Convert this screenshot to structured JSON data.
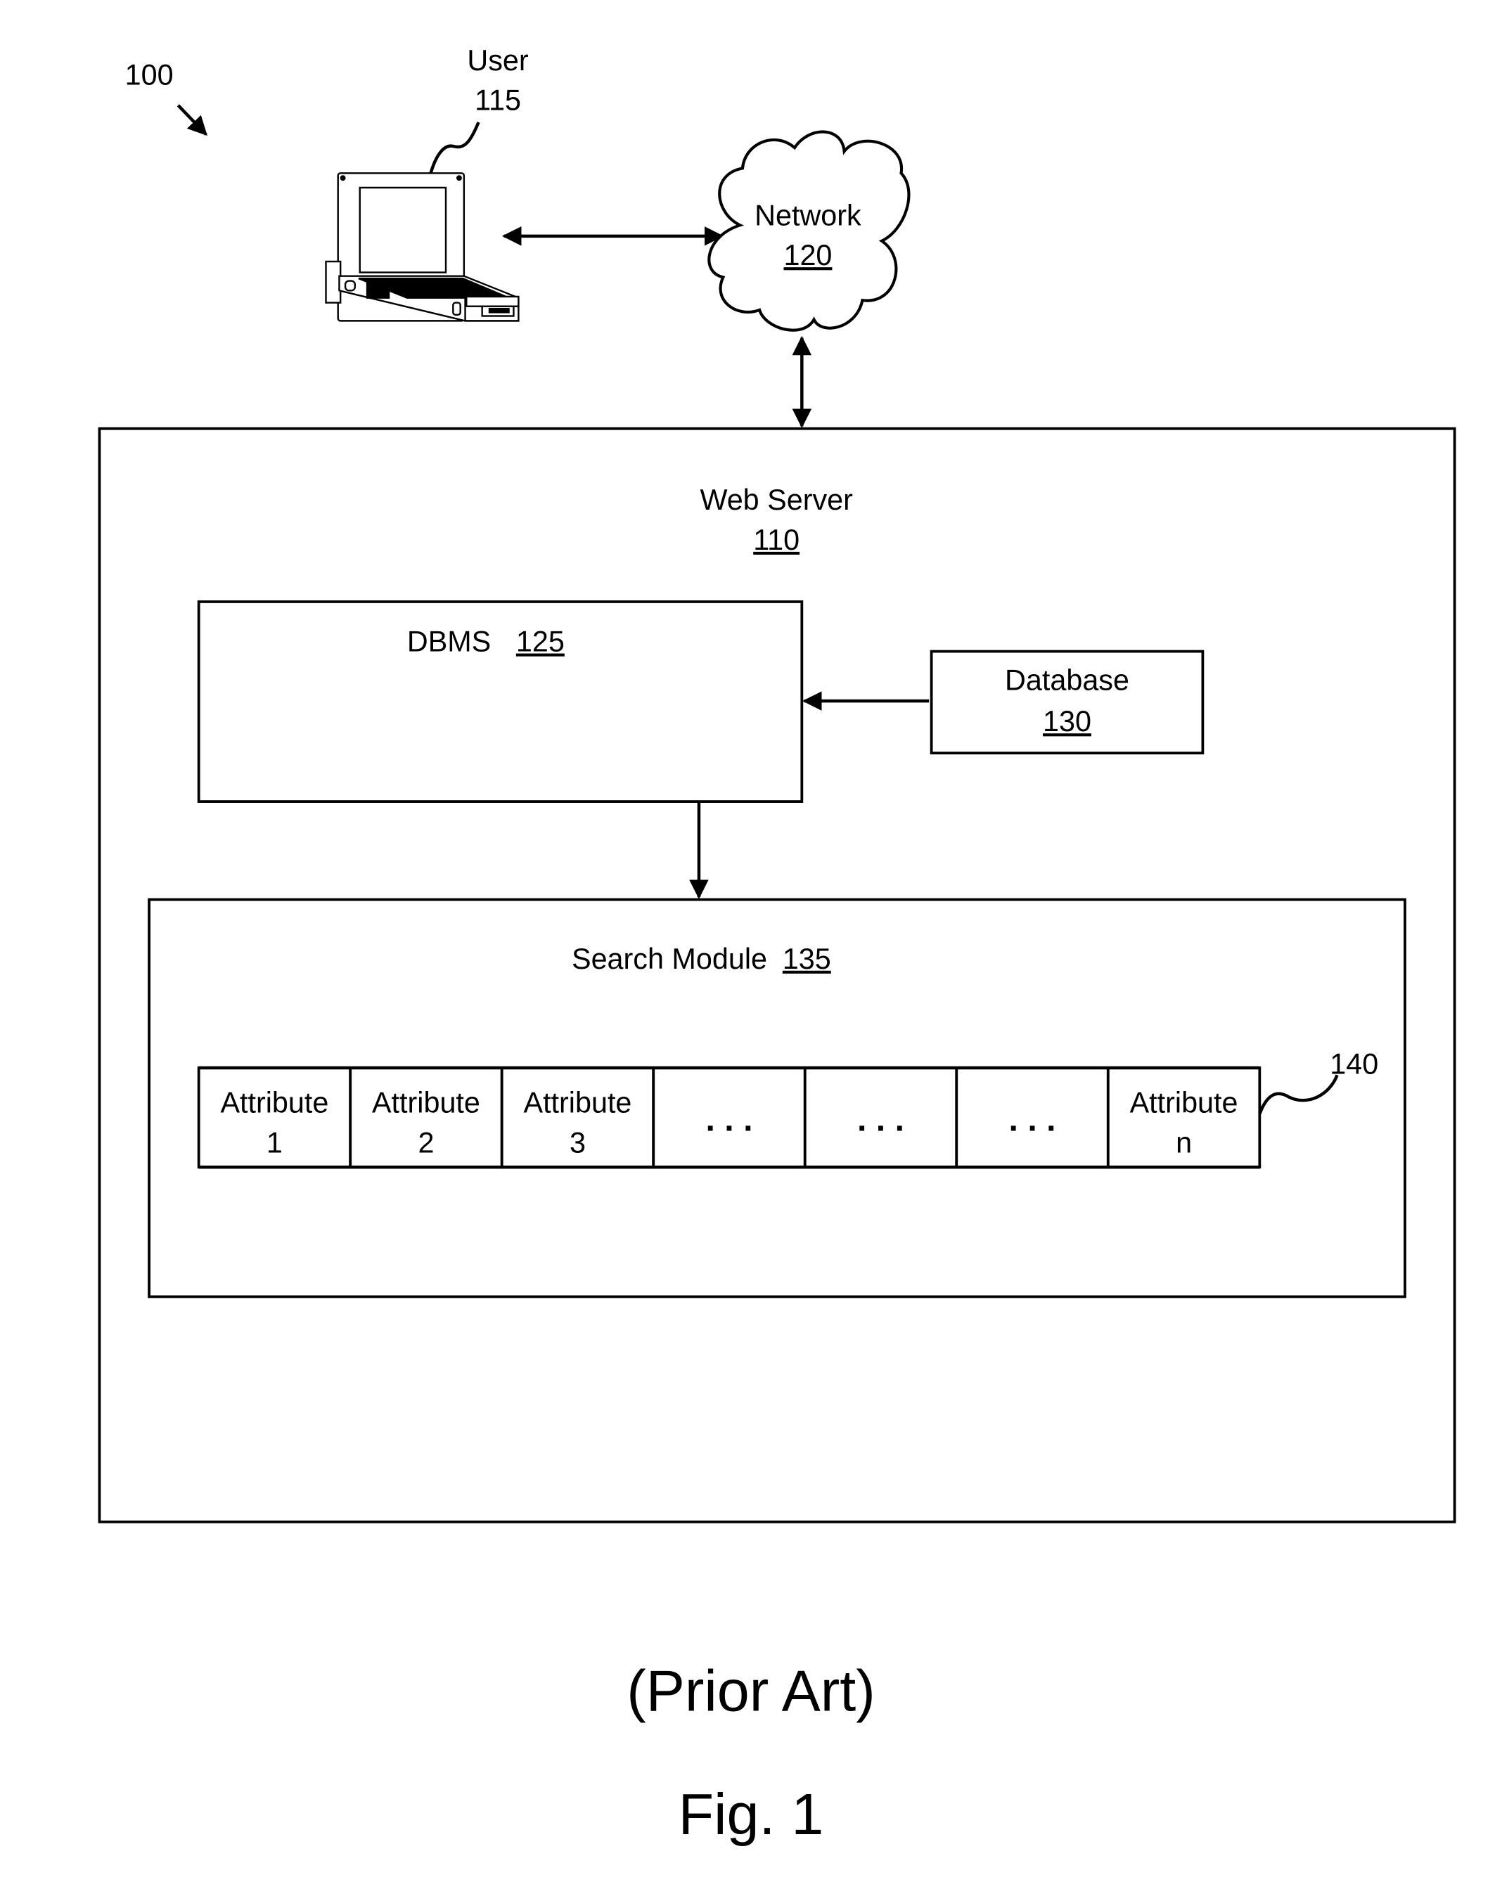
{
  "figure": {
    "ref_number": "100",
    "caption_note": "(Prior Art)",
    "caption": "Fig. 1"
  },
  "user": {
    "label": "User",
    "ref": "115",
    "icon": "laptop-icon"
  },
  "network": {
    "label": "Network",
    "ref": "120",
    "icon": "cloud-icon"
  },
  "web_server": {
    "label": "Web Server",
    "ref": "110"
  },
  "dbms": {
    "label": "DBMS",
    "ref": "125"
  },
  "database": {
    "label": "Database",
    "ref": "130"
  },
  "search_module": {
    "label": "Search Module",
    "ref": "135"
  },
  "attribute_row": {
    "ref": "140",
    "cells": [
      {
        "line1": "Attribute",
        "line2": "1"
      },
      {
        "line1": "Attribute",
        "line2": "2"
      },
      {
        "line1": "Attribute",
        "line2": "3"
      },
      {
        "line1": ". . .",
        "line2": ""
      },
      {
        "line1": ". . .",
        "line2": ""
      },
      {
        "line1": ". . .",
        "line2": ""
      },
      {
        "line1": "Attribute",
        "line2": "n"
      }
    ]
  }
}
